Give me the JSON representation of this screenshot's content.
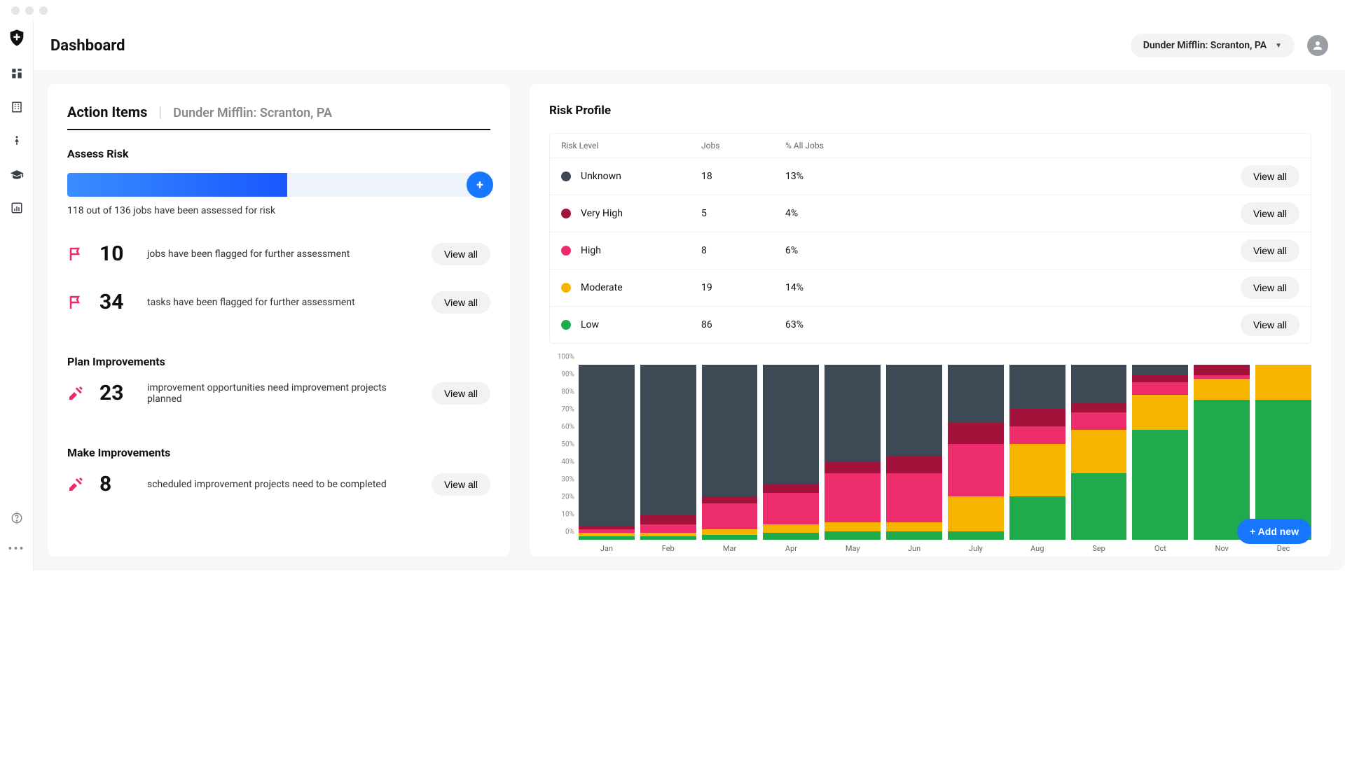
{
  "header": {
    "title": "Dashboard",
    "location": "Dunder Mifflin: Scranton, PA"
  },
  "action_items": {
    "title": "Action Items",
    "location": "Dunder Mifflin: Scranton, PA",
    "assess": {
      "title": "Assess Risk",
      "progress_label": "118 out of 136 jobs have been assessed for risk",
      "progress_pct": 52,
      "metrics": [
        {
          "value": "10",
          "label": "jobs have been flagged for further assessment",
          "icon": "flag-icon",
          "button": "View all"
        },
        {
          "value": "34",
          "label": "tasks have been flagged for further assessment",
          "icon": "flag-icon",
          "button": "View all"
        }
      ]
    },
    "plan": {
      "title": "Plan Improvements",
      "metrics": [
        {
          "value": "23",
          "label": "improvement opportunities need improvement projects planned",
          "icon": "tools-icon",
          "button": "View all"
        }
      ]
    },
    "make": {
      "title": "Make Improvements",
      "metrics": [
        {
          "value": "8",
          "label": "scheduled improvement projects need to be completed",
          "icon": "tools-icon",
          "button": "View all"
        }
      ]
    }
  },
  "risk_profile": {
    "title": "Risk Profile",
    "columns": {
      "level": "Risk Level",
      "jobs": "Jobs",
      "pct": "% All Jobs"
    },
    "rows": [
      {
        "label": "Unknown",
        "jobs": "18",
        "pct": "13%",
        "color": "#3d4a56",
        "button": "View all"
      },
      {
        "label": "Very High",
        "jobs": "5",
        "pct": "4%",
        "color": "#a3123a",
        "button": "View all"
      },
      {
        "label": "High",
        "jobs": "8",
        "pct": "6%",
        "color": "#ed2c6c",
        "button": "View all"
      },
      {
        "label": "Moderate",
        "jobs": "19",
        "pct": "14%",
        "color": "#f7b500",
        "button": "View all"
      },
      {
        "label": "Low",
        "jobs": "86",
        "pct": "63%",
        "color": "#1fab4c",
        "button": "View all"
      }
    ]
  },
  "chart_data": {
    "type": "bar",
    "title": "",
    "xlabel": "",
    "ylabel": "",
    "ylim": [
      0,
      100
    ],
    "yticks": [
      "0%",
      "10%",
      "20%",
      "30%",
      "40%",
      "50%",
      "60%",
      "70%",
      "80%",
      "90%",
      "100%"
    ],
    "categories": [
      "Jan",
      "Feb",
      "Mar",
      "Apr",
      "May",
      "Jun",
      "July",
      "Aug",
      "Sep",
      "Oct",
      "Nov",
      "Dec"
    ],
    "series": [
      {
        "name": "Low",
        "color": "#1fab4c",
        "values": [
          2,
          2,
          3,
          4,
          5,
          5,
          5,
          25,
          38,
          63,
          80,
          80
        ]
      },
      {
        "name": "Moderate",
        "color": "#f7b500",
        "values": [
          2,
          2,
          3,
          5,
          5,
          5,
          20,
          30,
          25,
          20,
          12,
          20
        ]
      },
      {
        "name": "High",
        "color": "#ed2c6c",
        "values": [
          2,
          5,
          15,
          18,
          28,
          28,
          30,
          10,
          10,
          7,
          2,
          0
        ]
      },
      {
        "name": "Very High",
        "color": "#a3123a",
        "values": [
          2,
          5,
          4,
          5,
          7,
          10,
          12,
          10,
          5,
          4,
          6,
          0
        ]
      },
      {
        "name": "Unknown",
        "color": "#3d4a56",
        "values": [
          92,
          86,
          75,
          68,
          55,
          52,
          33,
          25,
          22,
          6,
          0,
          0
        ]
      }
    ]
  },
  "buttons": {
    "add_new": "+ Add new"
  }
}
